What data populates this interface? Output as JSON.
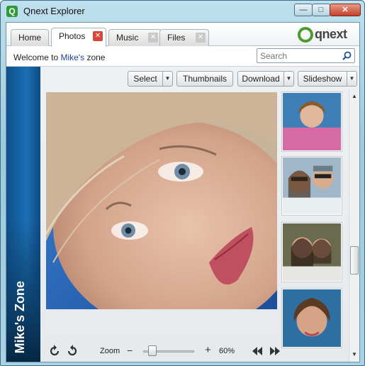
{
  "window": {
    "title": "Qnext Explorer",
    "app_icon": "Q",
    "minimize_glyph": "—",
    "maximize_glyph": "□",
    "close_glyph": "✕"
  },
  "tabs": [
    {
      "label": "Home",
      "active": false,
      "closable": false
    },
    {
      "label": "Photos",
      "active": true,
      "closable": true
    },
    {
      "label": "Music",
      "active": false,
      "closable": true
    },
    {
      "label": "Files",
      "active": false,
      "closable": true
    }
  ],
  "brand": {
    "text": "qnext",
    "color": "#4c9b2f"
  },
  "welcome": {
    "prefix": "Welcome to ",
    "user": "Mike's",
    "suffix": " zone"
  },
  "search": {
    "placeholder": "Search"
  },
  "toolbar": {
    "select_label": "Select",
    "thumbnails_label": "Thumbnails",
    "download_label": "Download",
    "slideshow_label": "Slideshow"
  },
  "side_banner": {
    "label": "Mike's Zone"
  },
  "zoom": {
    "label": "Zoom",
    "minus": "−",
    "plus": "+",
    "value_text": "60%",
    "value": 0.6
  },
  "colors": {
    "accent": "#1f3f8f",
    "close_active": "#d8453a",
    "banner": "#1c6fb3"
  }
}
